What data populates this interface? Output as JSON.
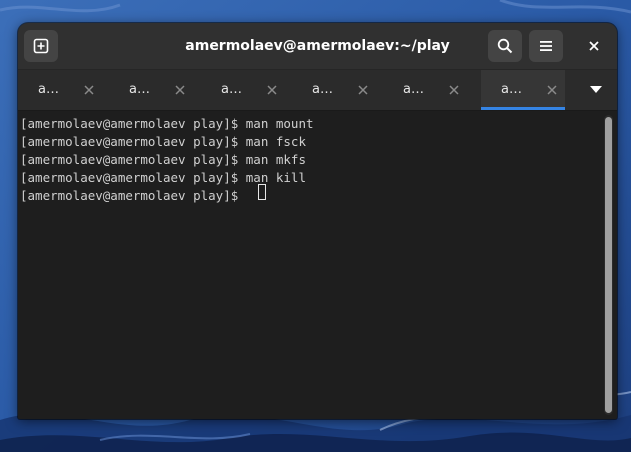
{
  "window": {
    "title": "amermolaev@amermolaev:~/play",
    "buttons": {
      "new_tab": "new-tab-icon",
      "search": "search-icon",
      "menu": "hamburger-menu-icon",
      "close": "close-icon"
    }
  },
  "tabs": [
    {
      "label": "a…",
      "active": false
    },
    {
      "label": "a…",
      "active": false
    },
    {
      "label": "a…",
      "active": false
    },
    {
      "label": "a…",
      "active": false
    },
    {
      "label": "a…",
      "active": false
    },
    {
      "label": "a…",
      "active": true
    }
  ],
  "terminal": {
    "lines": [
      "[amermolaev@amermolaev play]$ man mount",
      "[amermolaev@amermolaev play]$ man fsck",
      "[amermolaev@amermolaev play]$ man mkfs",
      "[amermolaev@amermolaev play]$ man kill",
      "[amermolaev@amermolaev play]$ "
    ]
  },
  "colors": {
    "accent": "#3584e4",
    "terminal_bg": "#1e1e1e",
    "headerbar_bg": "#303030",
    "text": "#d0d0d0"
  }
}
